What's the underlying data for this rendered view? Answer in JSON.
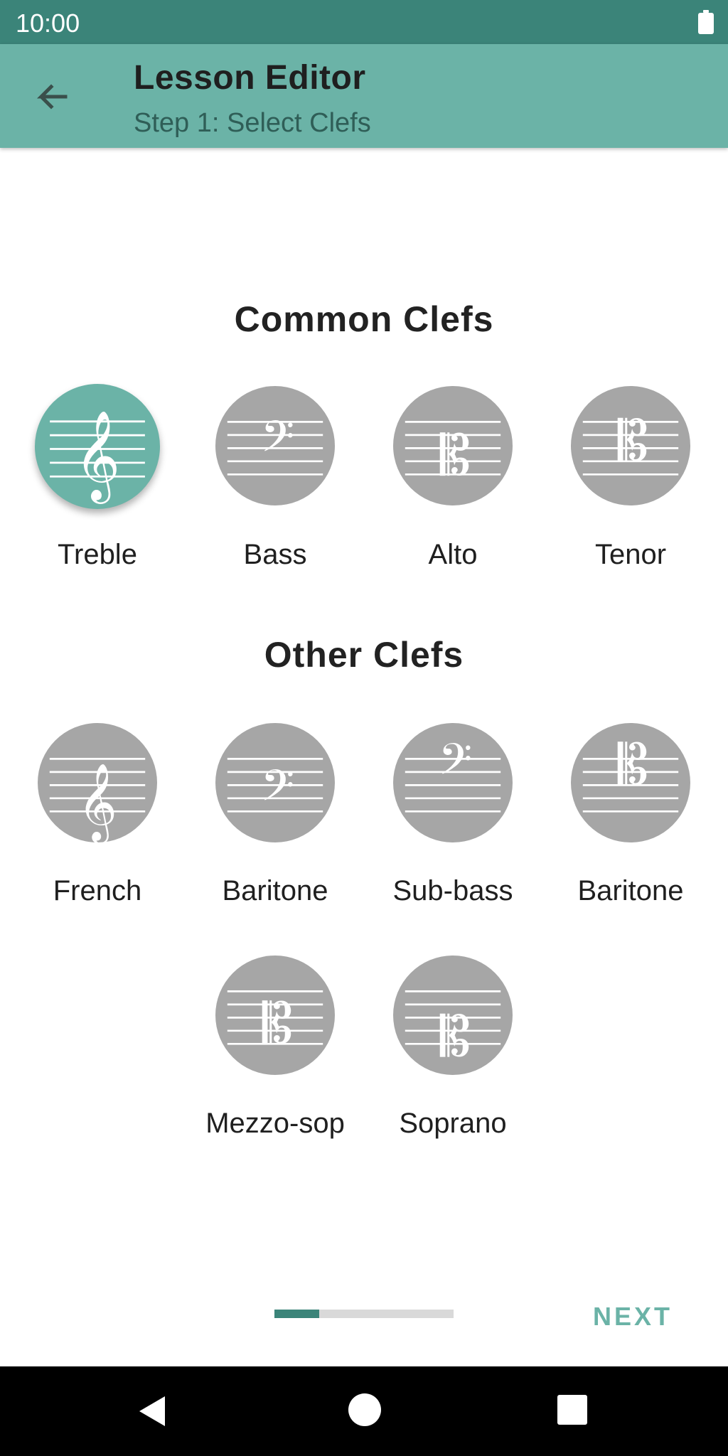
{
  "status_bar": {
    "time": "10:00",
    "battery_icon": "battery-full-icon"
  },
  "app_bar": {
    "title": "Lesson Editor",
    "subtitle": "Step 1: Select Clefs",
    "back_icon": "arrow-back-icon"
  },
  "common_section": {
    "heading": "Common Clefs",
    "clefs": [
      {
        "label": "Treble",
        "icon": "treble-clef-icon",
        "selected": true
      },
      {
        "label": "Bass",
        "icon": "bass-clef-icon",
        "selected": false
      },
      {
        "label": "Alto",
        "icon": "alto-clef-icon",
        "selected": false
      },
      {
        "label": "Tenor",
        "icon": "tenor-clef-icon",
        "selected": false
      }
    ]
  },
  "other_section": {
    "heading": "Other Clefs",
    "clefs": [
      {
        "label": "French",
        "icon": "french-clef-icon",
        "selected": false
      },
      {
        "label": "Baritone",
        "icon": "baritone-f-clef-icon",
        "selected": false
      },
      {
        "label": "Sub-bass",
        "icon": "sub-bass-clef-icon",
        "selected": false
      },
      {
        "label": "Baritone",
        "icon": "baritone-c-clef-icon",
        "selected": false
      },
      {
        "label": "Mezzo-sop",
        "icon": "mezzo-soprano-clef-icon",
        "selected": false
      },
      {
        "label": "Soprano",
        "icon": "soprano-clef-icon",
        "selected": false
      }
    ]
  },
  "footer": {
    "progress": 0.25,
    "next_label": "NEXT"
  },
  "nav_bar": {
    "back_icon": "nav-back-icon",
    "home_icon": "nav-home-icon",
    "recents_icon": "nav-recents-icon"
  },
  "colors": {
    "status_bar": "#3b8479",
    "app_bar": "#6bb3a7",
    "selected_clef": "#6bb3a7",
    "unselected_clef": "#a6a6a6",
    "progress_fill": "#3b8479",
    "progress_track": "#d9d9d9",
    "next_text": "#6bb3a7"
  }
}
